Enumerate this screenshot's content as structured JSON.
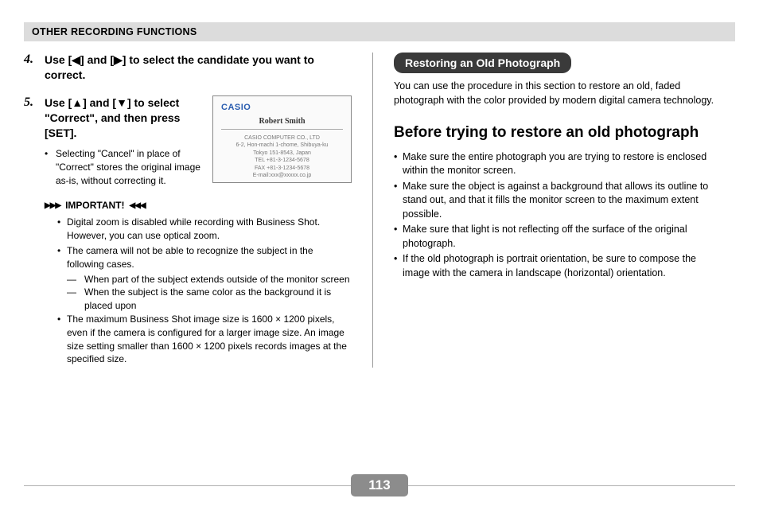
{
  "header": "OTHER RECORDING FUNCTIONS",
  "left": {
    "step4": {
      "num": "4.",
      "title_a": "Use [",
      "tri_left": "◀",
      "title_b": "] and [",
      "tri_right": "▶",
      "title_c": "] to select the candidate you want to correct."
    },
    "step5": {
      "num": "5.",
      "title_a": "Use [",
      "tri_up": "▲",
      "title_b": "] and [",
      "tri_down": "▼",
      "title_c": "] to select \"Correct\", and then press [SET].",
      "bullet": "Selecting \"Cancel\" in place of \"Correct\" stores the original image as-is, without correcting it."
    },
    "card": {
      "logo": "CASIO",
      "name": "Robert Smith",
      "lines": "CASIO COMPUTER CO., LTD\n6-2, Hon-machi 1-chome, Shibuya-ku\nTokyo 151-8543, Japan\nTEL +81-3-1234-5678\nFAX +81-3-1234-5678\nE-mail:xxx@xxxxx.co.jp"
    },
    "important": {
      "label": "IMPORTANT!",
      "items": [
        "Digital zoom is disabled while recording with Business Shot. However, you can use optical zoom.",
        "The camera will not be able to recognize the subject in the following cases."
      ],
      "dashes": [
        "When part of the subject extends outside of the monitor screen",
        "When the subject is the same color as the background it is placed upon"
      ],
      "item3": "The maximum Business Shot image size is 1600 × 1200 pixels, even if the camera is configured for a larger image size. An image size setting smaller than 1600 × 1200 pixels records images at the specified size."
    }
  },
  "right": {
    "pill": "Restoring an Old Photograph",
    "intro": "You can use the procedure in this section to restore an old, faded photograph with the color provided by modern digital camera technology.",
    "h2": "Before trying to restore an old photograph",
    "bullets": [
      "Make sure the entire photograph you are trying to restore is enclosed within the monitor screen.",
      "Make sure the object is against a background that allows its outline to stand out, and that it fills the monitor screen to the maximum extent possible.",
      "Make sure that light is not reflecting off the surface of the original photograph.",
      "If the old photograph is portrait orientation, be sure to compose the image with the camera in landscape (horizontal) orientation."
    ]
  },
  "page": "113"
}
